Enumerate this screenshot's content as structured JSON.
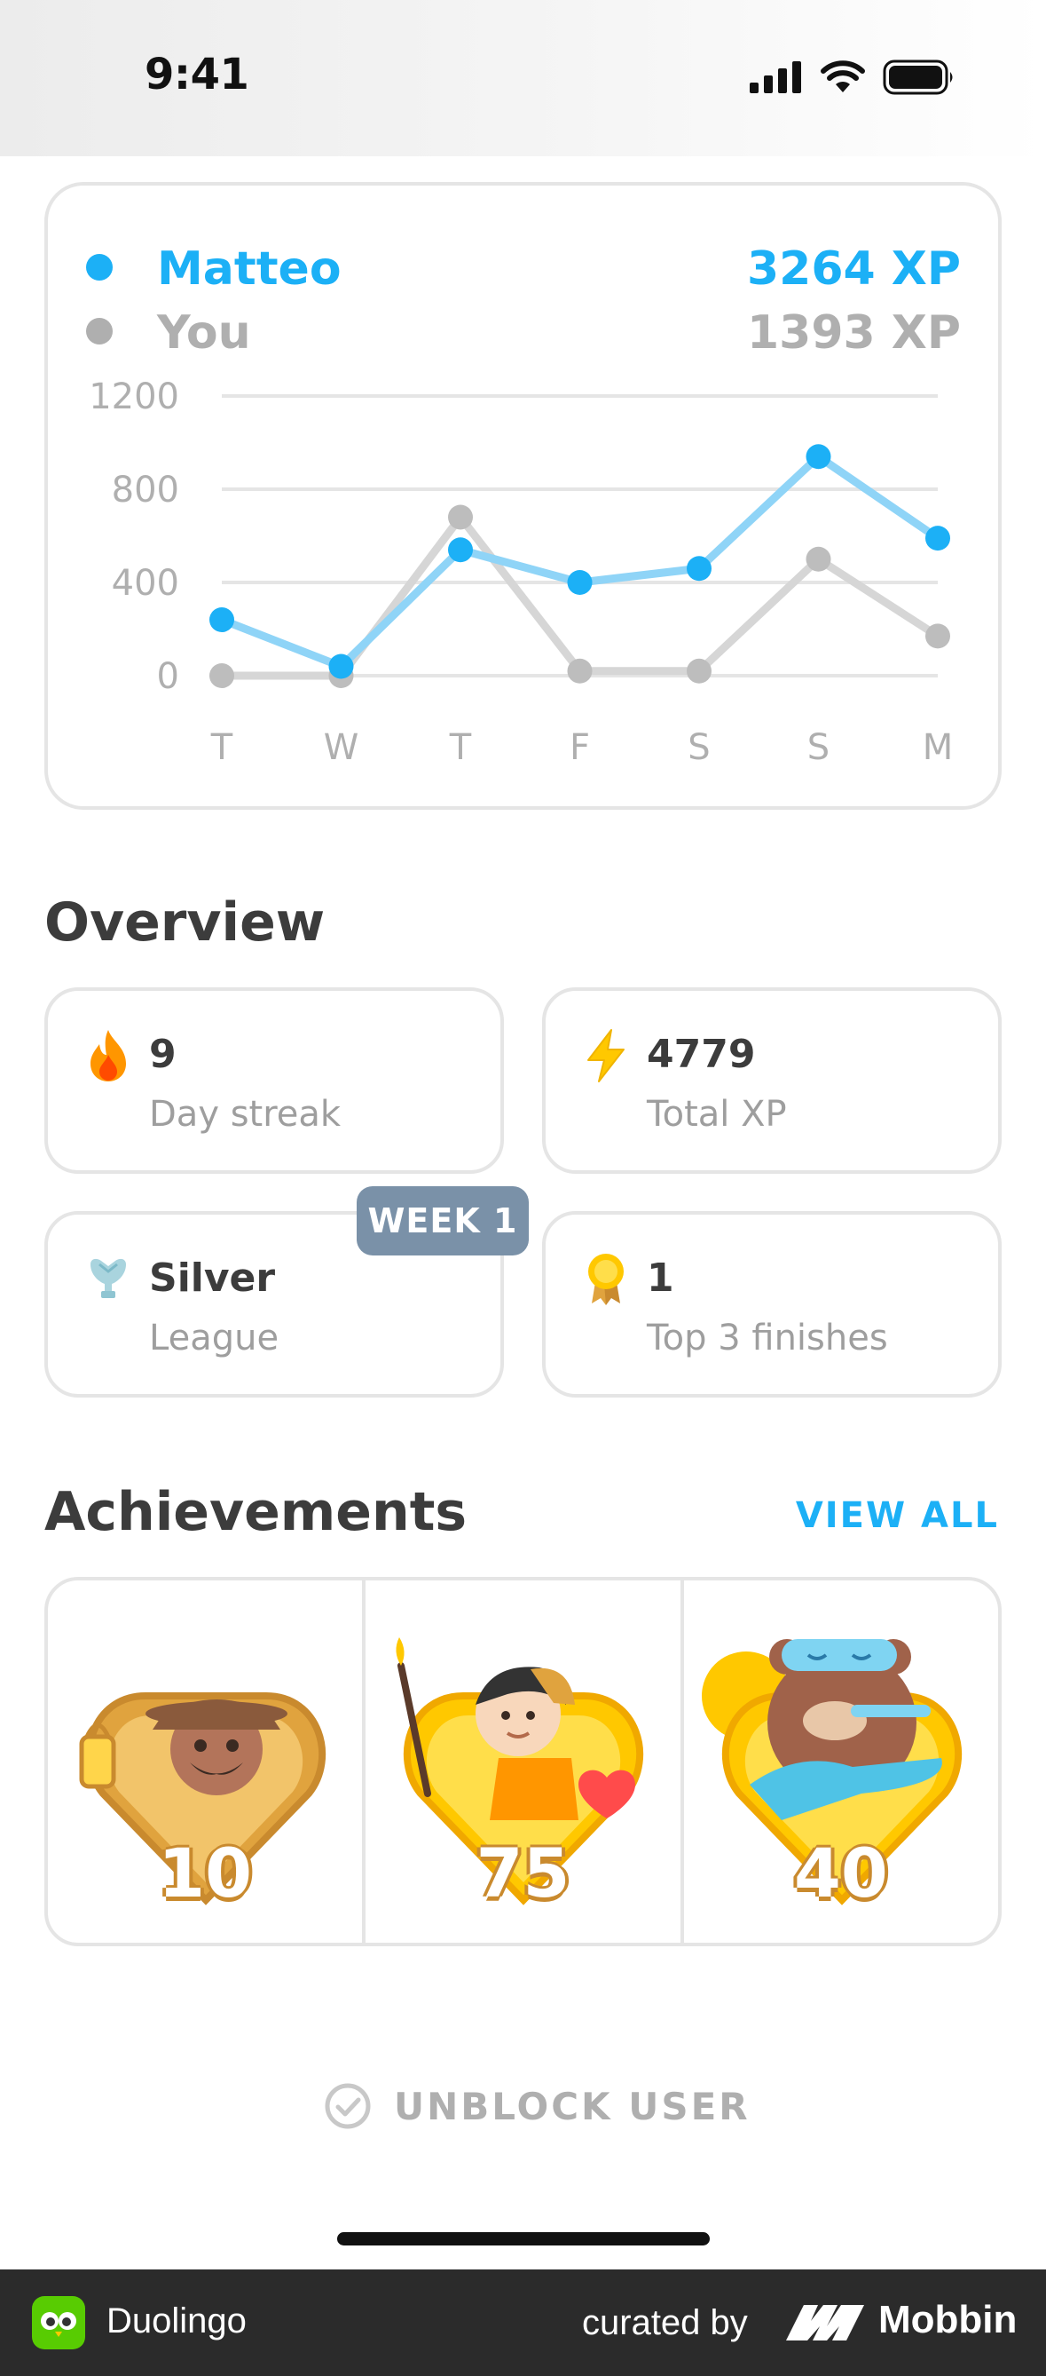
{
  "status_bar": {
    "time": "9:41"
  },
  "comparison": {
    "friend": {
      "name": "Matteo",
      "xp": "3264 XP",
      "color": "#1cb0f6"
    },
    "you": {
      "name": "You",
      "xp": "1393 XP",
      "color": "#afafaf"
    }
  },
  "chart_data": {
    "type": "line",
    "categories": [
      "T",
      "W",
      "T",
      "F",
      "S",
      "S",
      "M"
    ],
    "y_ticks": [
      "1200",
      "800",
      "400",
      "0"
    ],
    "ylim": [
      0,
      1200
    ],
    "grid": true,
    "series": [
      {
        "name": "Matteo",
        "color": "#1cb0f6",
        "values": [
          240,
          40,
          540,
          400,
          460,
          940,
          590
        ]
      },
      {
        "name": "You",
        "color": "#c4c4c4",
        "values": [
          0,
          0,
          680,
          20,
          20,
          500,
          170
        ]
      }
    ]
  },
  "overview": {
    "title": "Overview",
    "streak": {
      "value": "9",
      "label": "Day streak"
    },
    "total_xp": {
      "value": "4779",
      "label": "Total XP"
    },
    "league": {
      "value": "Silver",
      "label": "League",
      "badge": "WEEK 1"
    },
    "top3": {
      "value": "1",
      "label": "Top 3 finishes"
    }
  },
  "achievements": {
    "title": "Achievements",
    "view_all": "VIEW ALL",
    "items": [
      {
        "value": "10",
        "icon": "explorer-badge-icon"
      },
      {
        "value": "75",
        "icon": "lit-candle-badge-icon"
      },
      {
        "value": "40",
        "icon": "bear-badge-icon"
      }
    ]
  },
  "unblock": {
    "label": "UNBLOCK USER"
  },
  "footer": {
    "app": "Duolingo",
    "curated": "curated by",
    "brand": "Mobbin"
  }
}
